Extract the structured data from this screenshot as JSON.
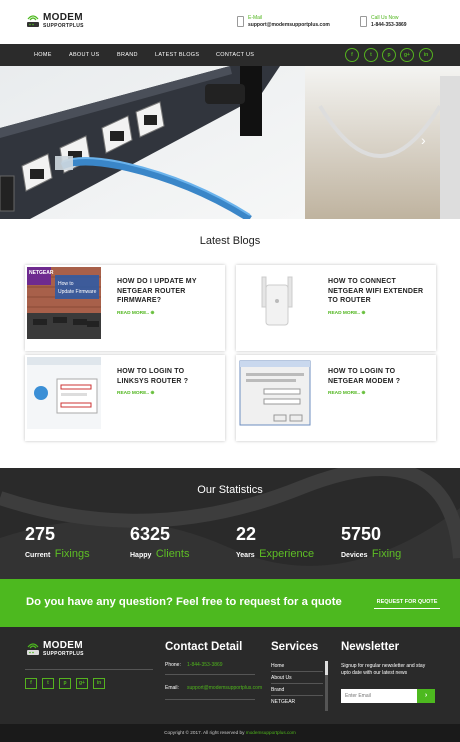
{
  "header": {
    "logo_title": "MODEM",
    "logo_sub": "SUPPORTPLUS",
    "email_label": "E-Mail",
    "email_value": "support@modemsupportplus.com",
    "call_label": "Call Us Now",
    "call_value": "1-844-353-3869"
  },
  "nav": {
    "items": [
      "HOME",
      "ABOUT US",
      "BRAND",
      "LATEST BLOGS",
      "CONTACT US"
    ],
    "social": [
      "f",
      "t",
      "p",
      "g+",
      "in"
    ]
  },
  "hero": {
    "next_arrow": "›"
  },
  "blogs": {
    "title": "Latest Blogs",
    "cards": [
      {
        "title": "HOW DO I UPDATE MY NETGEAR ROUTER FIRMWARE?",
        "more": "READ MORE.. ⊕",
        "img_label": "How to Update Firmware",
        "img_brand": "NETGEAR"
      },
      {
        "title": "HOW TO CONNECT NETGEAR WIFI EXTENDER TO ROUTER",
        "more": "READ MORE.. ⊕"
      },
      {
        "title": "HOW TO LOGIN TO LINKSYS ROUTER ?",
        "more": "READ MORE.. ⊕"
      },
      {
        "title": "HOW TO LOGIN TO NETGEAR MODEM ?",
        "more": "READ MORE.. ⊕"
      }
    ]
  },
  "stats": {
    "title": "Our Statistics",
    "items": [
      {
        "num": "275",
        "word": "Current",
        "green": "Fixings"
      },
      {
        "num": "6325",
        "word": "Happy",
        "green": "Clients"
      },
      {
        "num": "22",
        "word": "Years",
        "green": "Experience"
      },
      {
        "num": "5750",
        "word": "Devices",
        "green": "Fixing"
      }
    ]
  },
  "quote": {
    "text": "Do you have any question? Feel free to request for a quote",
    "button": "REQUEST FOR QUOTE"
  },
  "footer": {
    "logo_title": "MODEM",
    "logo_sub": "SUPPORTPLUS",
    "social": [
      "f",
      "t",
      "p",
      "g+",
      "in"
    ],
    "contact_title": "Contact Detail",
    "phone_label": "Phone:",
    "phone_value": "1-844-353-3869",
    "email_label": "Email:",
    "email_value": "support@modemsupportplus.com",
    "services_title": "Services",
    "services": [
      "Home",
      "About Us",
      "Brand",
      "NETGEAR"
    ],
    "newsletter_title": "Newsletter",
    "newsletter_text": "Signup for regular newsletter and stay upto date with our latest news",
    "email_placeholder": "Enter Email",
    "submit": "›",
    "copyright_prefix": "Copyright © 2017. All right reserved by",
    "copyright_link": "modemsupportplus.com"
  },
  "colors": {
    "accent": "#4db91f",
    "dark": "#2b2b2b"
  }
}
